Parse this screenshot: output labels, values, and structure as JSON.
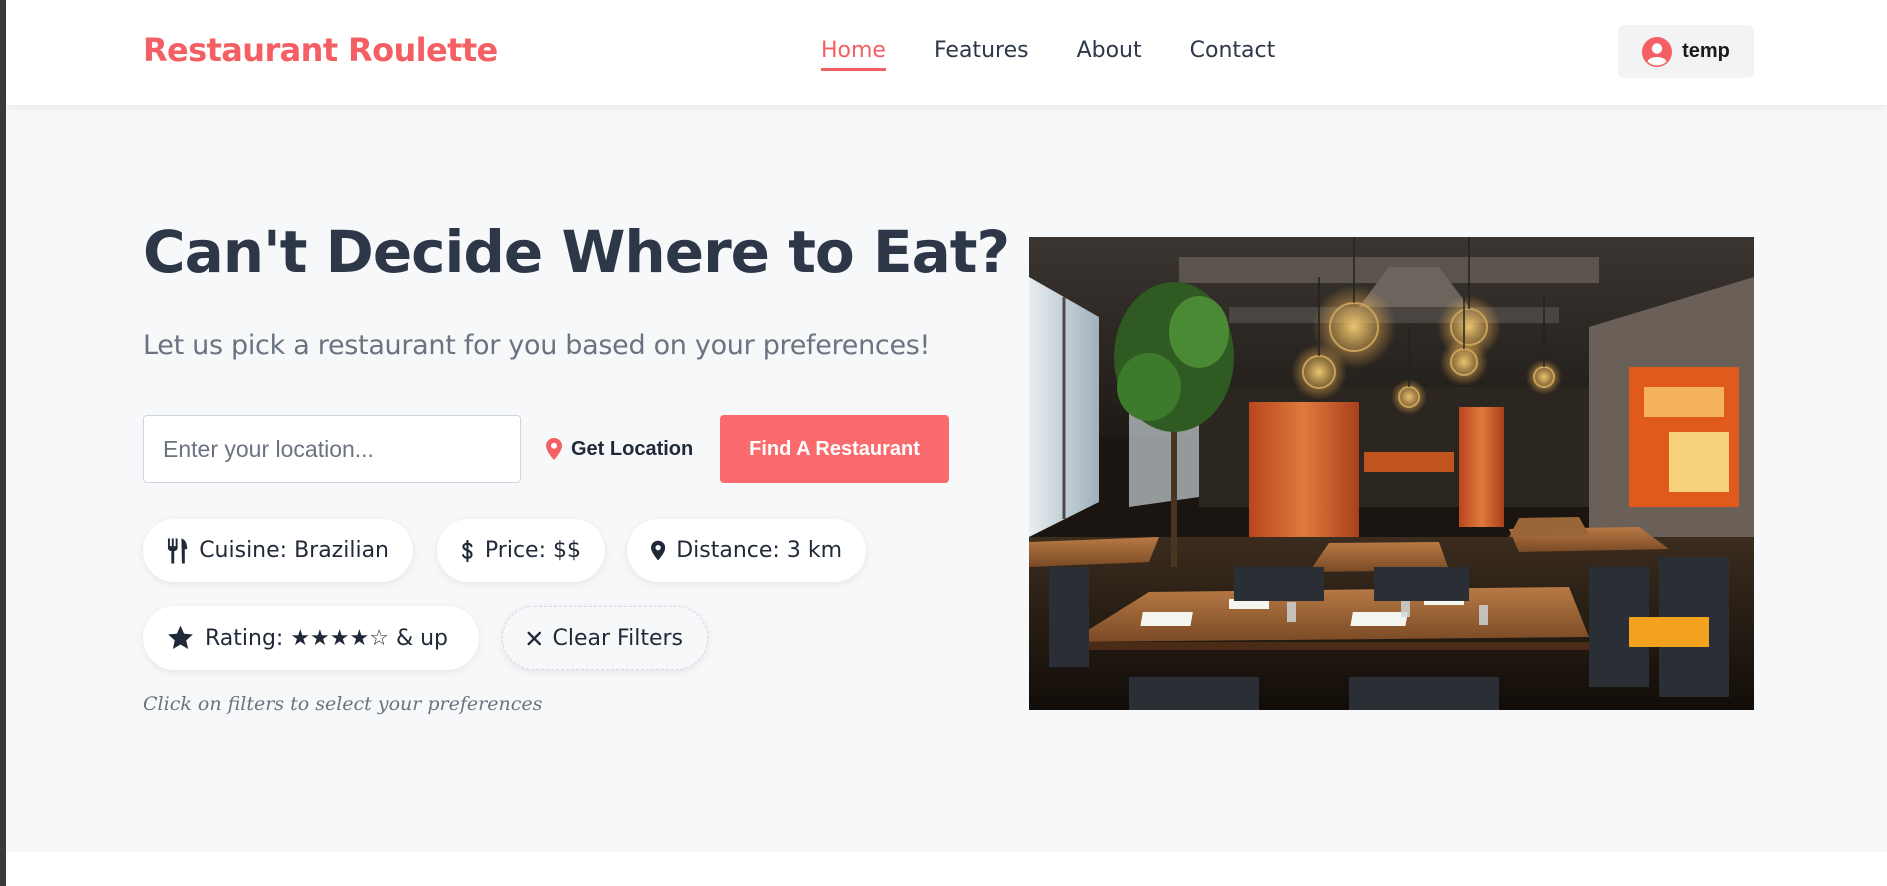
{
  "brand": {
    "name": "Restaurant Roulette",
    "color": "#f45f63"
  },
  "nav": {
    "items": [
      {
        "label": "Home",
        "active": true
      },
      {
        "label": "Features",
        "active": false
      },
      {
        "label": "About",
        "active": false
      },
      {
        "label": "Contact",
        "active": false
      }
    ]
  },
  "user": {
    "name": "temp",
    "icon": "user-circle-icon"
  },
  "hero": {
    "title": "Can't Decide Where to Eat?",
    "subtitle": "Let us pick a restaurant for you based on your preferences!",
    "location_placeholder": "Enter your location...",
    "location_value": "",
    "get_location_label": "Get Location",
    "find_button_label": "Find A Restaurant",
    "accent_color": "#fb6a6c"
  },
  "filters": [
    {
      "label": "Cuisine: Brazilian",
      "icon": "utensils-icon"
    },
    {
      "label": "Price: $$",
      "icon": "dollar-icon"
    },
    {
      "label": "Distance: 3 km",
      "icon": "map-pin-icon"
    },
    {
      "label": "Rating: ★★★★☆ & up",
      "icon": "star-icon"
    },
    {
      "label": "Clear Filters",
      "icon": "close-icon"
    }
  ],
  "hint": "Click on filters to select your preferences"
}
